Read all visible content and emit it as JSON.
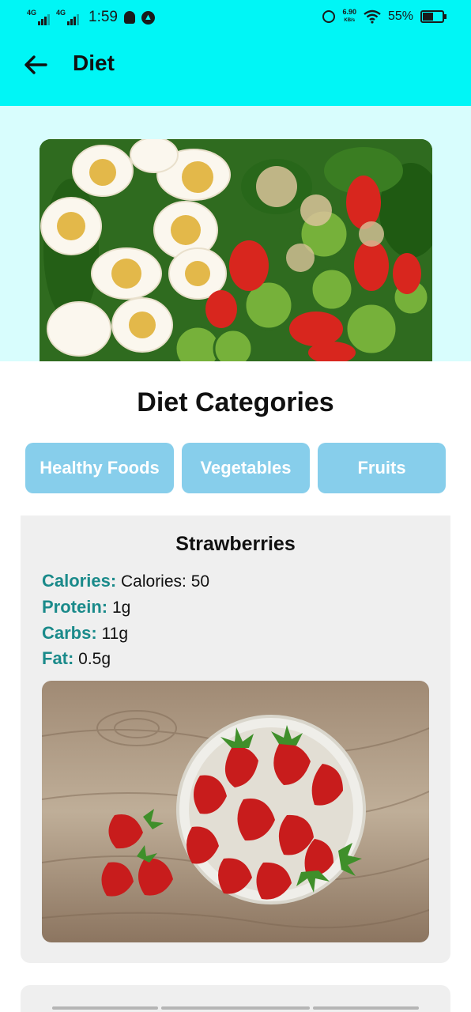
{
  "status_bar": {
    "net1": "4G",
    "net2": "4G",
    "time": "1:59",
    "speed_value": "6.90",
    "speed_unit": "KB/s",
    "battery": "55%",
    "battery_level": 0.55
  },
  "app_bar": {
    "title": "Diet",
    "back_icon": "arrow-left-icon"
  },
  "hero": {
    "image": "salad-photo"
  },
  "categories": {
    "title": "Diet Categories",
    "buttons": [
      {
        "label": "Healthy Foods"
      },
      {
        "label": "Vegetables"
      },
      {
        "label": "Fruits"
      }
    ]
  },
  "food": {
    "name": "Strawberries",
    "nutrients": [
      {
        "label": "Calories:",
        "value": "Calories: 50"
      },
      {
        "label": "Protein:",
        "value": "1g"
      },
      {
        "label": "Carbs:",
        "value": "11g"
      },
      {
        "label": "Fat:",
        "value": "0.5g"
      }
    ],
    "image": "strawberries-photo"
  },
  "colors": {
    "app_bar": "#00f6f6",
    "hero_band": "#d8fdfd",
    "category_button": "#87ceeb",
    "nutrient_label": "#1a8a8a",
    "card_bg": "#efefef"
  }
}
